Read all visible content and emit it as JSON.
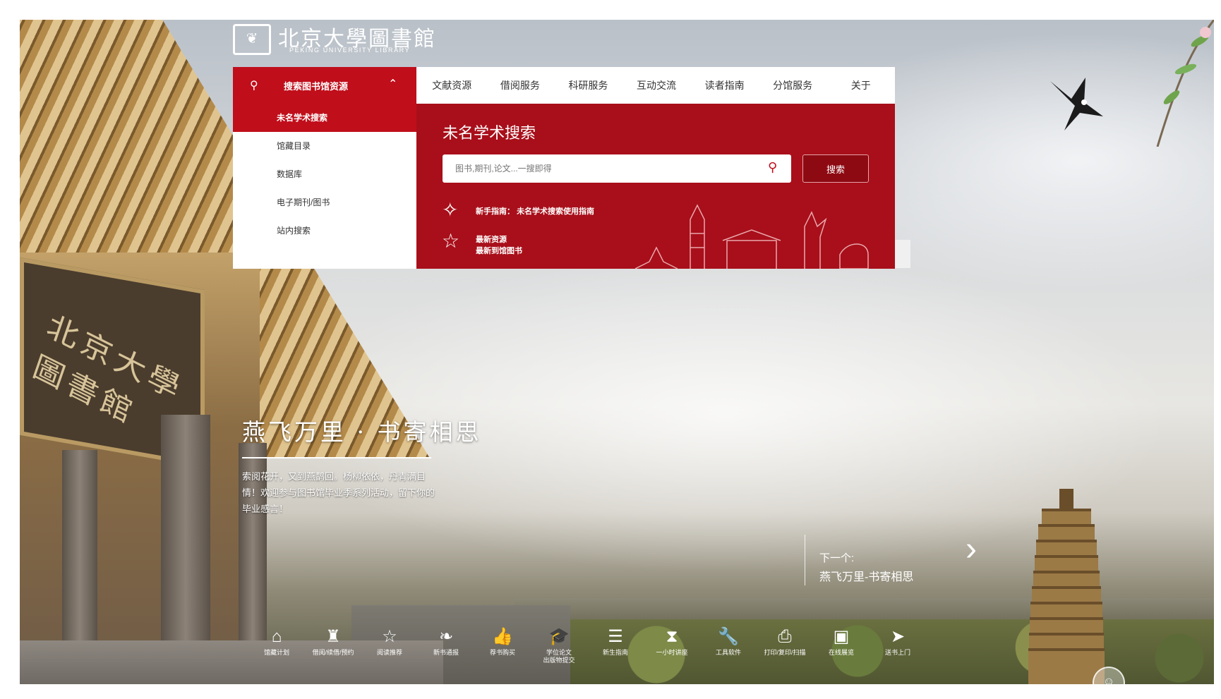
{
  "logo": {
    "name_cn": "北京大學圖書館",
    "name_en": "PEKING UNIVERSITY LIBRARY",
    "seal": "❦"
  },
  "search_tab": {
    "label": "搜索图书馆资源",
    "icon": "search-icon",
    "chevron": "chevron-up-icon"
  },
  "nav": {
    "items": [
      "文献资源",
      "借阅服务",
      "科研服务",
      "互动交流",
      "读者指南",
      "分馆服务",
      "关于"
    ]
  },
  "dropdown": {
    "items": [
      "未名学术搜索",
      "馆藏目录",
      "数据库",
      "电子期刊/图书",
      "站内搜索"
    ],
    "active_index": 0
  },
  "search_panel": {
    "title": "未名学术搜索",
    "placeholder": "图书,期刊,论文...一搜即得",
    "button_label": "搜索",
    "guide_label": "新手指南：",
    "guide_link": "未名学术搜索使用指南",
    "new_label": "最新资源",
    "new_link": "最新到馆图书"
  },
  "banner": {
    "headline": "燕飞万里 · 书寄相思",
    "description": "索阅花开，又到燕鹊回。杨柳依依，丹青满目情！欢迎参与图书馆毕业季系列活动，留下你的毕业感言！",
    "next_label": "下一个:",
    "next_title": "燕飞万里-书寄相思"
  },
  "quick_links": [
    {
      "icon": "home-icon",
      "glyph": "⌂",
      "label": "馆藏计划"
    },
    {
      "icon": "reader-icon",
      "glyph": "♜",
      "label": "借阅/续借/预约"
    },
    {
      "icon": "star-icon",
      "glyph": "☆",
      "label": "阅读推荐"
    },
    {
      "icon": "leaf-icon",
      "glyph": "❧",
      "label": "新书通报"
    },
    {
      "icon": "thumbs-up-icon",
      "glyph": "👍",
      "label": "荐书购买"
    },
    {
      "icon": "graduation-cap-icon",
      "glyph": "🎓",
      "label": "学位论文\n出版物提交"
    },
    {
      "icon": "list-icon",
      "glyph": "☰",
      "label": "新生指南"
    },
    {
      "icon": "hourglass-icon",
      "glyph": "⧗",
      "label": "一小时讲座"
    },
    {
      "icon": "wrench-icon",
      "glyph": "🔧",
      "label": "工具软件"
    },
    {
      "icon": "printer-icon",
      "glyph": "⎙",
      "label": "打印/复印/扫描"
    },
    {
      "icon": "image-icon",
      "glyph": "▣",
      "label": "在线展览"
    },
    {
      "icon": "paper-plane-icon",
      "glyph": "➤",
      "label": "送书上门"
    }
  ],
  "colors": {
    "brand_red": "#c00e1b",
    "panel_red": "#a80f1a"
  }
}
